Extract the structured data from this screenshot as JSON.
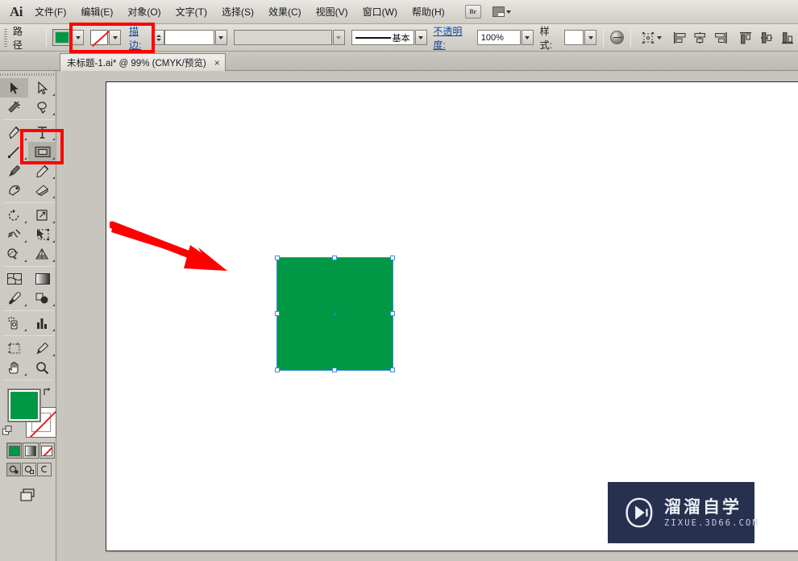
{
  "app": {
    "logo": "Ai",
    "menu_items": [
      {
        "label": "文件(F)",
        "name": "menu-file"
      },
      {
        "label": "编辑(E)",
        "name": "menu-edit"
      },
      {
        "label": "对象(O)",
        "name": "menu-object"
      },
      {
        "label": "文字(T)",
        "name": "menu-type"
      },
      {
        "label": "选择(S)",
        "name": "menu-select"
      },
      {
        "label": "效果(C)",
        "name": "menu-effect"
      },
      {
        "label": "视图(V)",
        "name": "menu-view"
      },
      {
        "label": "窗口(W)",
        "name": "menu-window"
      },
      {
        "label": "帮助(H)",
        "name": "menu-help"
      }
    ],
    "bridge_label": "Br"
  },
  "control_bar": {
    "selection_label": "路径",
    "fill_color": "#009845",
    "stroke_label": "描边:",
    "stroke_weight": "",
    "stroke_profile": "",
    "brush_label": "基本",
    "opacity_label": "不透明度:",
    "opacity_value": "100%",
    "style_label": "样式:"
  },
  "document_tab": {
    "title": "未标题-1.ai* @ 99% (CMYK/预览)",
    "close": "×"
  },
  "toolbox": {
    "tools": [
      {
        "name": "selection-tool",
        "row": 0,
        "col": 0
      },
      {
        "name": "direct-selection-tool",
        "row": 0,
        "col": 1
      },
      {
        "name": "magic-wand-tool",
        "row": 1,
        "col": 0
      },
      {
        "name": "lasso-tool",
        "row": 1,
        "col": 1
      },
      {
        "name": "pen-tool",
        "row": 2,
        "col": 0
      },
      {
        "name": "type-tool",
        "row": 2,
        "col": 1
      },
      {
        "name": "line-segment-tool",
        "row": 3,
        "col": 0
      },
      {
        "name": "rectangle-tool",
        "row": 3,
        "col": 1,
        "selected": true
      },
      {
        "name": "paintbrush-tool",
        "row": 4,
        "col": 0
      },
      {
        "name": "pencil-tool",
        "row": 4,
        "col": 1
      },
      {
        "name": "blob-brush-tool",
        "row": 5,
        "col": 0
      },
      {
        "name": "eraser-tool",
        "row": 5,
        "col": 1
      },
      {
        "name": "rotate-tool",
        "row": 6,
        "col": 0
      },
      {
        "name": "scale-tool",
        "row": 6,
        "col": 1
      },
      {
        "name": "width-tool",
        "row": 7,
        "col": 0
      },
      {
        "name": "free-transform-tool",
        "row": 7,
        "col": 1
      },
      {
        "name": "shape-builder-tool",
        "row": 8,
        "col": 0
      },
      {
        "name": "perspective-grid-tool",
        "row": 8,
        "col": 1
      },
      {
        "name": "mesh-tool",
        "row": 9,
        "col": 0
      },
      {
        "name": "gradient-tool",
        "row": 9,
        "col": 1
      },
      {
        "name": "eyedropper-tool",
        "row": 10,
        "col": 0
      },
      {
        "name": "blend-tool",
        "row": 10,
        "col": 1
      },
      {
        "name": "symbol-sprayer-tool",
        "row": 11,
        "col": 0
      },
      {
        "name": "column-graph-tool",
        "row": 11,
        "col": 1
      },
      {
        "name": "artboard-tool",
        "row": 12,
        "col": 0
      },
      {
        "name": "slice-tool",
        "row": 12,
        "col": 1
      },
      {
        "name": "hand-tool",
        "row": 13,
        "col": 0
      },
      {
        "name": "zoom-tool",
        "row": 13,
        "col": 1
      }
    ],
    "fill_color": "#009845",
    "stroke_color": "none"
  },
  "canvas": {
    "shape_fill": "#009845",
    "selection_color": "#3f8fd1"
  },
  "annotations": {
    "highlight_color": "#ff0000",
    "arrow_color": "#ff0000"
  },
  "watermark": {
    "title": "溜溜自学",
    "subtitle": "ZIXUE.3D66.COM",
    "bg_color": "#27304f"
  }
}
